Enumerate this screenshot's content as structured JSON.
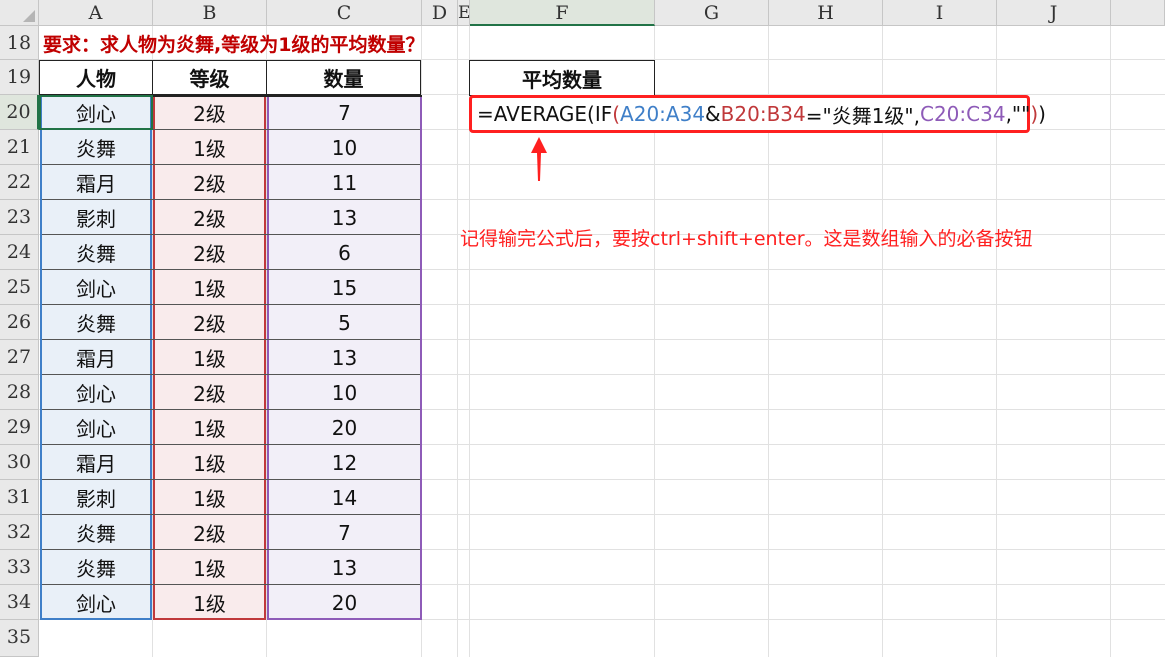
{
  "columns": [
    "A",
    "B",
    "C",
    "D",
    "E",
    "F",
    "G",
    "H",
    "I",
    "J"
  ],
  "rows": [
    "18",
    "19",
    "20",
    "21",
    "22",
    "23",
    "24",
    "25",
    "26",
    "27",
    "28",
    "29",
    "30",
    "31",
    "32",
    "33",
    "34",
    "35"
  ],
  "title": "要求：求人物为炎舞,等级为1级的平均数量？",
  "table": {
    "headers": [
      "人物",
      "等级",
      "数量"
    ],
    "rows": [
      [
        "剑心",
        "2级",
        "7"
      ],
      [
        "炎舞",
        "1级",
        "10"
      ],
      [
        "霜月",
        "2级",
        "11"
      ],
      [
        "影刺",
        "2级",
        "13"
      ],
      [
        "炎舞",
        "2级",
        "6"
      ],
      [
        "剑心",
        "1级",
        "15"
      ],
      [
        "炎舞",
        "2级",
        "5"
      ],
      [
        "霜月",
        "1级",
        "13"
      ],
      [
        "剑心",
        "2级",
        "10"
      ],
      [
        "剑心",
        "1级",
        "20"
      ],
      [
        "霜月",
        "1级",
        "12"
      ],
      [
        "影刺",
        "1级",
        "14"
      ],
      [
        "炎舞",
        "2级",
        "7"
      ],
      [
        "炎舞",
        "1级",
        "13"
      ],
      [
        "剑心",
        "1级",
        "20"
      ]
    ]
  },
  "avg_header": "平均数量",
  "formula": {
    "p1": "=AVERAGE(IF",
    "p2": "(",
    "p3": "A20:A34",
    "p4": "&",
    "p5": "B20:B34",
    "p6": "=\"炎舞1级\",",
    "p7": "C20:C34",
    "p8": ",\"\"",
    "p9": ")",
    "p10": ")"
  },
  "note": "记得输完公式后，要按ctrl+shift+enter。这是数组输入的必备按钮",
  "colors": {
    "accent": "#ff2020",
    "title": "#c00000",
    "rangeA": "#3f7fc8",
    "rangeB": "#c0393b",
    "rangeC": "#8e5bb8"
  }
}
